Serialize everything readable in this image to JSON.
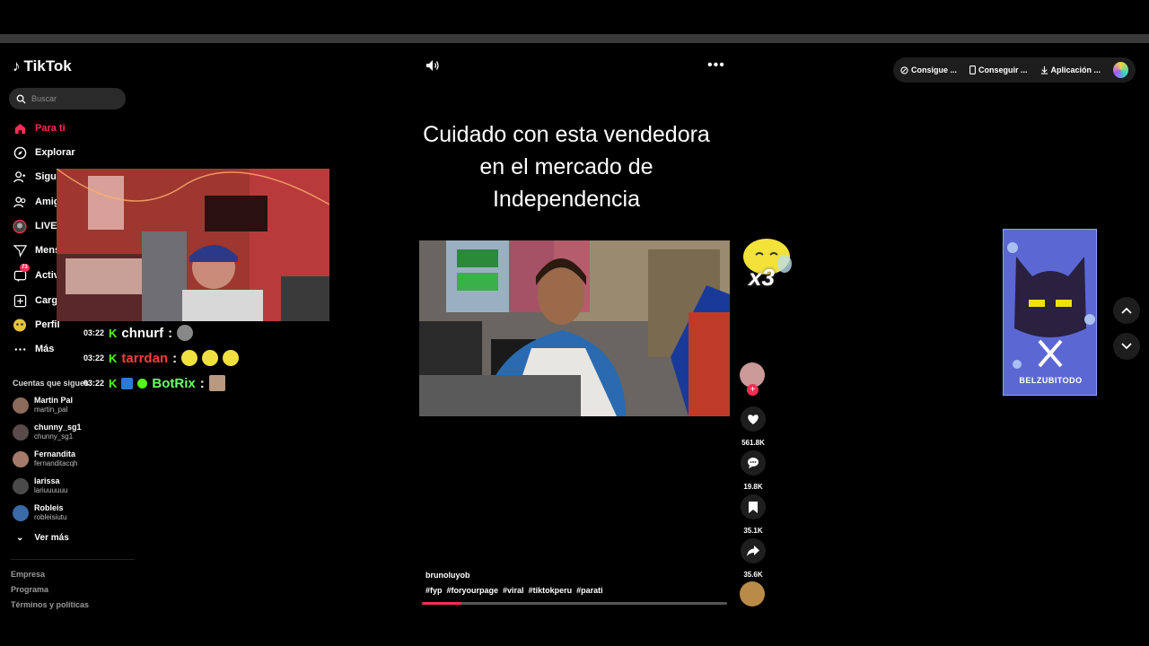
{
  "app": {
    "name": "TikTok"
  },
  "search": {
    "placeholder": "Buscar"
  },
  "nav": [
    {
      "label": "Para ti",
      "icon": "home-icon",
      "active": true
    },
    {
      "label": "Explorar",
      "icon": "compass-icon"
    },
    {
      "label": "Siguiendo",
      "icon": "following-icon"
    },
    {
      "label": "Amigos",
      "icon": "friends-icon"
    },
    {
      "label": "LIVE",
      "icon": "live-icon"
    },
    {
      "label": "Mensajes",
      "icon": "messages-icon"
    },
    {
      "label": "Actividad",
      "icon": "activity-icon",
      "badge": "73"
    },
    {
      "label": "Cargar",
      "icon": "upload-icon"
    },
    {
      "label": "Perfil",
      "icon": "profile-icon"
    },
    {
      "label": "Más",
      "icon": "more-icon"
    }
  ],
  "following": {
    "title": "Cuentas que sigues",
    "accounts": [
      {
        "name": "Martin Pal",
        "handle": "martin_pal"
      },
      {
        "name": "chunny_sg1",
        "handle": "chunny_sg1"
      },
      {
        "name": "Fernandita",
        "handle": "fernanditacqh"
      },
      {
        "name": "larissa",
        "handle": "lariuuuuuu"
      },
      {
        "name": "Robleis",
        "handle": "robleisiutu"
      }
    ],
    "see_more": "Ver más"
  },
  "footer": {
    "links": [
      "Empresa",
      "Programa",
      "Términos y políticas"
    ]
  },
  "chat": [
    {
      "time": "03:22",
      "user": "chnurf",
      "sep": ":",
      "color": "#ffffff"
    },
    {
      "time": "03:22",
      "user": "tarrdan",
      "sep": ":",
      "color": "#ff3b3b"
    },
    {
      "time": "03:22",
      "user": "BotRix",
      "sep": ":",
      "color": "#6cff6c"
    }
  ],
  "video": {
    "caption": "Cuidado con esta vendedora en el mercado de Independencia",
    "author": "brunoluyob",
    "hashtags": [
      "#fyp",
      "#foryourpage",
      "#viral",
      "#tiktokperu",
      "#parati"
    ],
    "progress": 0.13
  },
  "actions": {
    "likes": "561.8K",
    "comments": "19.8K",
    "saves": "35.1K",
    "shares": "35.6K"
  },
  "overlay": {
    "multiplier": "x3",
    "ad_text": "BELZUBITODO"
  },
  "top_bar": {
    "items": [
      "Consigue ...",
      "Conseguir ...",
      "Aplicación ..."
    ]
  },
  "colors": {
    "accent": "#fe2c55",
    "background": "#000000"
  }
}
